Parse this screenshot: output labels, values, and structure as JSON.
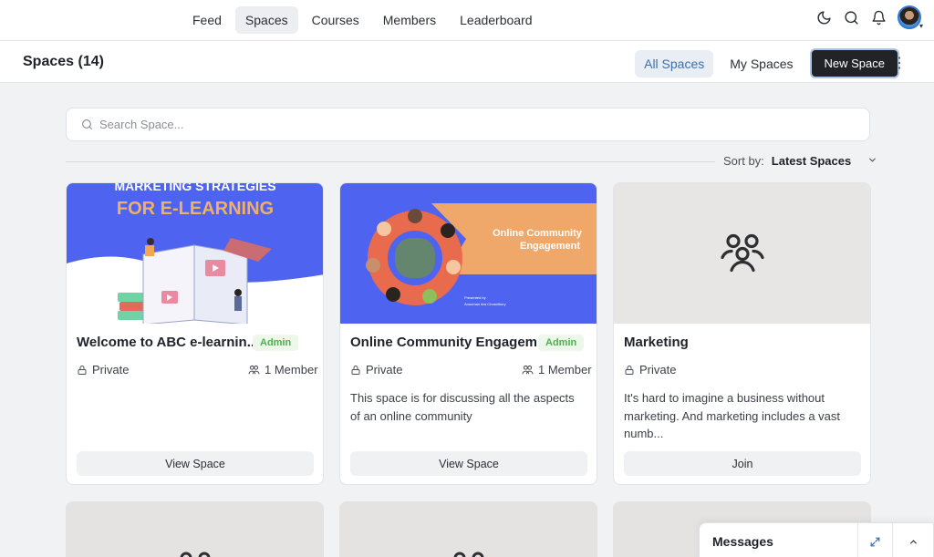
{
  "nav": {
    "items": [
      {
        "label": "Feed",
        "active": false
      },
      {
        "label": "Spaces",
        "active": true
      },
      {
        "label": "Courses",
        "active": false
      },
      {
        "label": "Members",
        "active": false
      },
      {
        "label": "Leaderboard",
        "active": false
      }
    ],
    "icons": [
      "moon-icon",
      "search-icon",
      "bell-icon"
    ]
  },
  "header": {
    "title": "Spaces (14)",
    "tabs": [
      {
        "label": "All Spaces",
        "active": true
      },
      {
        "label": "My Spaces",
        "active": false
      }
    ],
    "new_button": "New Space"
  },
  "search": {
    "placeholder": "Search Space..."
  },
  "sort": {
    "label": "Sort by:",
    "value": "Latest Spaces"
  },
  "cards": [
    {
      "title": "Welcome to ABC e-learnin...",
      "badge": "Admin",
      "privacy": "Private",
      "members": "1 Member",
      "description": "",
      "button": "View Space",
      "banner_title_1": "MARKETING STRATEGIES",
      "banner_title_2": "FOR E-LEARNING"
    },
    {
      "title": "Online Community Engagem...",
      "badge": "Admin",
      "privacy": "Private",
      "members": "1 Member",
      "description": "This space is for discussing all the aspects of an online community",
      "button": "View Space",
      "banner_title_1": "Online Community",
      "banner_title_2": "Engagement",
      "banner_small_1": "Presented by",
      "banner_small_2": "Anuuman Ara Chowdhury"
    },
    {
      "title": "Marketing",
      "badge": "",
      "privacy": "Private",
      "members": "",
      "description": "It's hard to imagine a business without marketing. And marketing includes a vast numb...",
      "button": "Join"
    }
  ],
  "messages": {
    "label": "Messages"
  },
  "colors": {
    "accent": "#3a6fb0",
    "admin_green": "#4caf50",
    "banner_blue": "#4e63f0",
    "banner_orange": "#f0b066",
    "dark_button": "#212327"
  }
}
